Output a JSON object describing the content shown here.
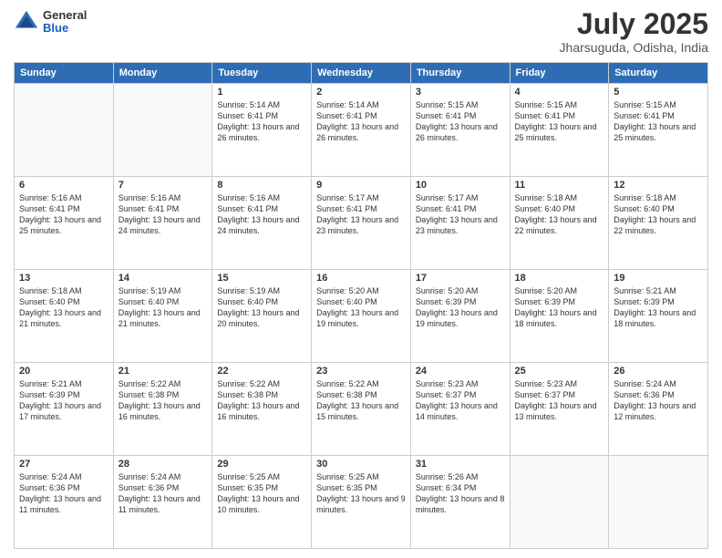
{
  "header": {
    "logo_general": "General",
    "logo_blue": "Blue",
    "month": "July 2025",
    "location": "Jharsuguda, Odisha, India"
  },
  "days_of_week": [
    "Sunday",
    "Monday",
    "Tuesday",
    "Wednesday",
    "Thursday",
    "Friday",
    "Saturday"
  ],
  "weeks": [
    [
      {
        "day": "",
        "info": ""
      },
      {
        "day": "",
        "info": ""
      },
      {
        "day": "1",
        "info": "Sunrise: 5:14 AM\nSunset: 6:41 PM\nDaylight: 13 hours\nand 26 minutes."
      },
      {
        "day": "2",
        "info": "Sunrise: 5:14 AM\nSunset: 6:41 PM\nDaylight: 13 hours\nand 26 minutes."
      },
      {
        "day": "3",
        "info": "Sunrise: 5:15 AM\nSunset: 6:41 PM\nDaylight: 13 hours\nand 26 minutes."
      },
      {
        "day": "4",
        "info": "Sunrise: 5:15 AM\nSunset: 6:41 PM\nDaylight: 13 hours\nand 25 minutes."
      },
      {
        "day": "5",
        "info": "Sunrise: 5:15 AM\nSunset: 6:41 PM\nDaylight: 13 hours\nand 25 minutes."
      }
    ],
    [
      {
        "day": "6",
        "info": "Sunrise: 5:16 AM\nSunset: 6:41 PM\nDaylight: 13 hours\nand 25 minutes."
      },
      {
        "day": "7",
        "info": "Sunrise: 5:16 AM\nSunset: 6:41 PM\nDaylight: 13 hours\nand 24 minutes."
      },
      {
        "day": "8",
        "info": "Sunrise: 5:16 AM\nSunset: 6:41 PM\nDaylight: 13 hours\nand 24 minutes."
      },
      {
        "day": "9",
        "info": "Sunrise: 5:17 AM\nSunset: 6:41 PM\nDaylight: 13 hours\nand 23 minutes."
      },
      {
        "day": "10",
        "info": "Sunrise: 5:17 AM\nSunset: 6:41 PM\nDaylight: 13 hours\nand 23 minutes."
      },
      {
        "day": "11",
        "info": "Sunrise: 5:18 AM\nSunset: 6:40 PM\nDaylight: 13 hours\nand 22 minutes."
      },
      {
        "day": "12",
        "info": "Sunrise: 5:18 AM\nSunset: 6:40 PM\nDaylight: 13 hours\nand 22 minutes."
      }
    ],
    [
      {
        "day": "13",
        "info": "Sunrise: 5:18 AM\nSunset: 6:40 PM\nDaylight: 13 hours\nand 21 minutes."
      },
      {
        "day": "14",
        "info": "Sunrise: 5:19 AM\nSunset: 6:40 PM\nDaylight: 13 hours\nand 21 minutes."
      },
      {
        "day": "15",
        "info": "Sunrise: 5:19 AM\nSunset: 6:40 PM\nDaylight: 13 hours\nand 20 minutes."
      },
      {
        "day": "16",
        "info": "Sunrise: 5:20 AM\nSunset: 6:40 PM\nDaylight: 13 hours\nand 19 minutes."
      },
      {
        "day": "17",
        "info": "Sunrise: 5:20 AM\nSunset: 6:39 PM\nDaylight: 13 hours\nand 19 minutes."
      },
      {
        "day": "18",
        "info": "Sunrise: 5:20 AM\nSunset: 6:39 PM\nDaylight: 13 hours\nand 18 minutes."
      },
      {
        "day": "19",
        "info": "Sunrise: 5:21 AM\nSunset: 6:39 PM\nDaylight: 13 hours\nand 18 minutes."
      }
    ],
    [
      {
        "day": "20",
        "info": "Sunrise: 5:21 AM\nSunset: 6:39 PM\nDaylight: 13 hours\nand 17 minutes."
      },
      {
        "day": "21",
        "info": "Sunrise: 5:22 AM\nSunset: 6:38 PM\nDaylight: 13 hours\nand 16 minutes."
      },
      {
        "day": "22",
        "info": "Sunrise: 5:22 AM\nSunset: 6:38 PM\nDaylight: 13 hours\nand 16 minutes."
      },
      {
        "day": "23",
        "info": "Sunrise: 5:22 AM\nSunset: 6:38 PM\nDaylight: 13 hours\nand 15 minutes."
      },
      {
        "day": "24",
        "info": "Sunrise: 5:23 AM\nSunset: 6:37 PM\nDaylight: 13 hours\nand 14 minutes."
      },
      {
        "day": "25",
        "info": "Sunrise: 5:23 AM\nSunset: 6:37 PM\nDaylight: 13 hours\nand 13 minutes."
      },
      {
        "day": "26",
        "info": "Sunrise: 5:24 AM\nSunset: 6:36 PM\nDaylight: 13 hours\nand 12 minutes."
      }
    ],
    [
      {
        "day": "27",
        "info": "Sunrise: 5:24 AM\nSunset: 6:36 PM\nDaylight: 13 hours\nand 11 minutes."
      },
      {
        "day": "28",
        "info": "Sunrise: 5:24 AM\nSunset: 6:36 PM\nDaylight: 13 hours\nand 11 minutes."
      },
      {
        "day": "29",
        "info": "Sunrise: 5:25 AM\nSunset: 6:35 PM\nDaylight: 13 hours\nand 10 minutes."
      },
      {
        "day": "30",
        "info": "Sunrise: 5:25 AM\nSunset: 6:35 PM\nDaylight: 13 hours\nand 9 minutes."
      },
      {
        "day": "31",
        "info": "Sunrise: 5:26 AM\nSunset: 6:34 PM\nDaylight: 13 hours\nand 8 minutes."
      },
      {
        "day": "",
        "info": ""
      },
      {
        "day": "",
        "info": ""
      }
    ]
  ]
}
